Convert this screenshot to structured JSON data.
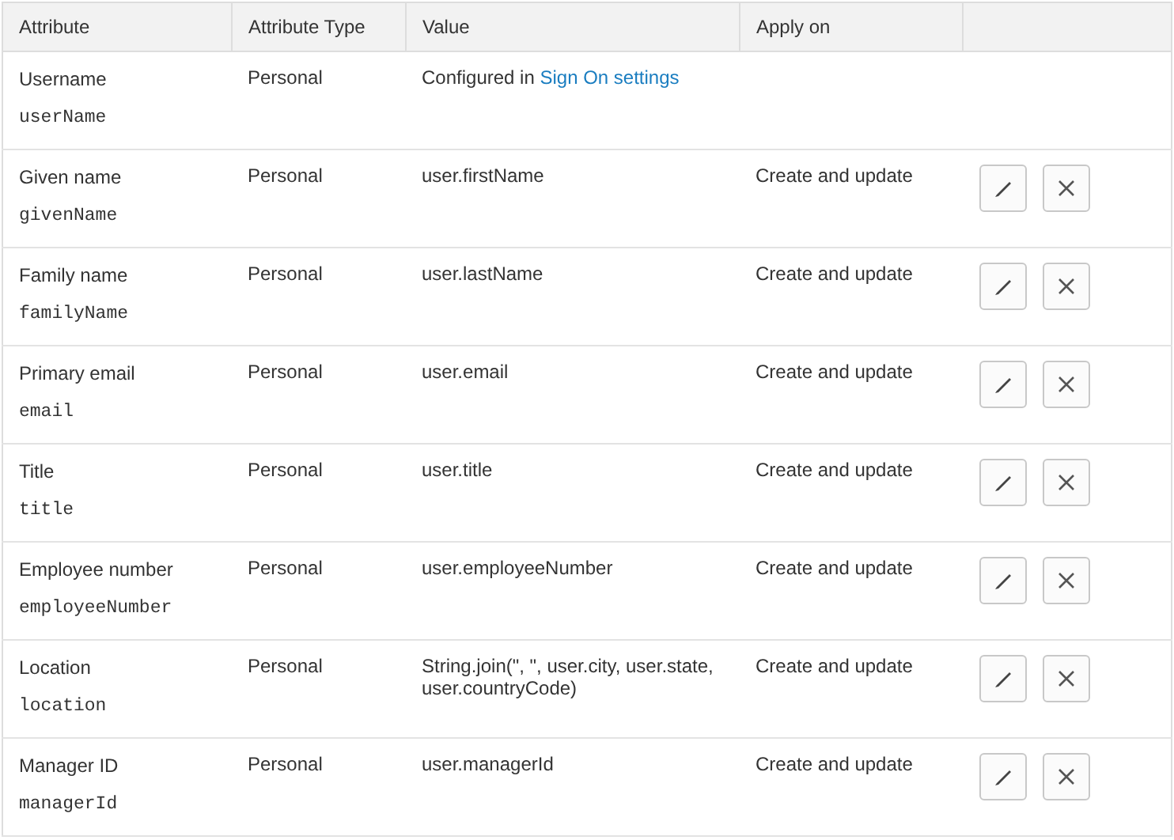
{
  "table": {
    "columns": [
      "Attribute",
      "Attribute Type",
      "Value",
      "Apply on"
    ],
    "rows": [
      {
        "name": "Username",
        "variable": "userName",
        "type": "Personal",
        "value": "Configured in ",
        "value_link": "Sign On settings",
        "apply_on": null,
        "actions": false
      },
      {
        "name": "Given name",
        "variable": "givenName",
        "type": "Personal",
        "value": "user.firstName",
        "apply_on": "Create and update",
        "actions": true
      },
      {
        "name": "Family name",
        "variable": "familyName",
        "type": "Personal",
        "value": "user.lastName",
        "apply_on": "Create and update",
        "actions": true
      },
      {
        "name": "Primary email",
        "variable": "email",
        "type": "Personal",
        "value": "user.email",
        "apply_on": "Create and update",
        "actions": true
      },
      {
        "name": "Title",
        "variable": "title",
        "type": "Personal",
        "value": "user.title",
        "apply_on": "Create and update",
        "actions": true
      },
      {
        "name": "Employee number",
        "variable": "employeeNumber",
        "type": "Personal",
        "value": "user.employeeNumber",
        "apply_on": "Create and update",
        "actions": true
      },
      {
        "name": "Location",
        "variable": "location",
        "type": "Personal",
        "value": "String.join(\", \", user.city, user.state, user.countryCode)",
        "apply_on": "Create and update",
        "actions": true
      },
      {
        "name": "Manager ID",
        "variable": "managerId",
        "type": "Personal",
        "value": "user.managerId",
        "apply_on": "Create and update",
        "actions": true
      }
    ]
  }
}
